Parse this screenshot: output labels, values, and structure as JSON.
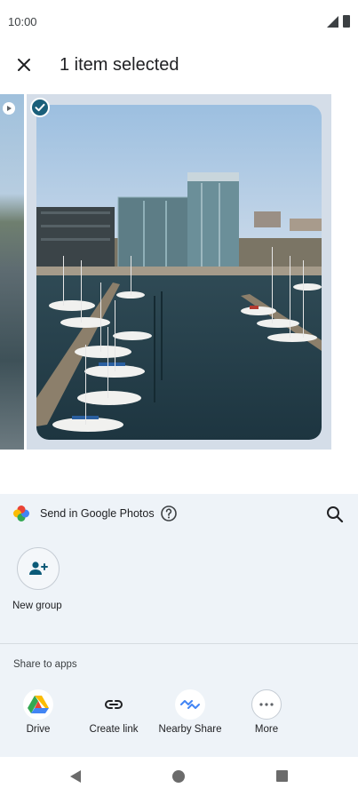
{
  "status": {
    "time": "10:00",
    "icons": [
      "signal-icon",
      "battery-icon"
    ]
  },
  "header": {
    "title": "1 item selected",
    "close_icon": "close-icon"
  },
  "photos": {
    "selected_count": 1,
    "selected_badge_icon": "check-icon",
    "prev_badge_icon": "play-icon"
  },
  "share_sheet": {
    "title": "Send in Google Photos",
    "help_icon": "help-icon",
    "search_icon": "search-icon",
    "group_item": {
      "label": "New group",
      "icon": "add-group-icon"
    },
    "section_label": "Share to apps",
    "apps": [
      {
        "label": "Drive",
        "icon": "drive-icon"
      },
      {
        "label": "Create link",
        "icon": "link-icon"
      },
      {
        "label": "Nearby Share",
        "icon": "nearby-share-icon"
      },
      {
        "label": "More",
        "icon": "more-icon"
      }
    ]
  },
  "colors": {
    "sheet_background": "#eef3f8",
    "accent": "#1a5f7a",
    "selection_frame": "#d4dde8"
  }
}
